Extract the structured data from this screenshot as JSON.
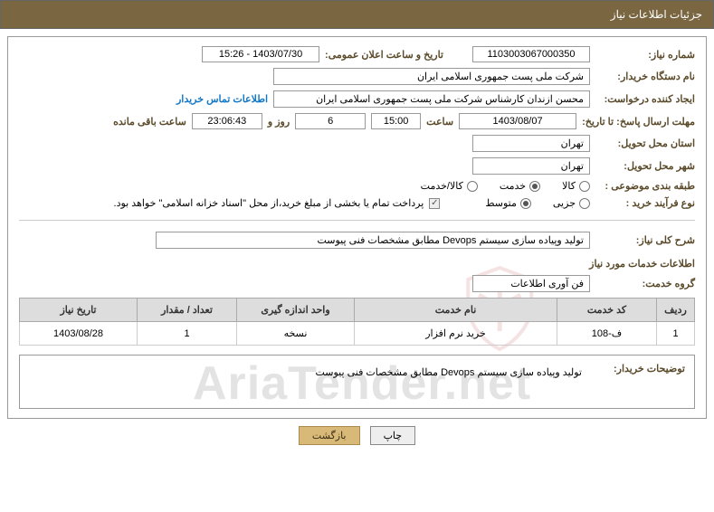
{
  "header": {
    "title": "جزئیات اطلاعات نیاز"
  },
  "fields": {
    "need_number_label": "شماره نیاز:",
    "need_number": "1103003067000350",
    "announce_label": "تاریخ و ساعت اعلان عمومی:",
    "announce_value": "1403/07/30 - 15:26",
    "buyer_org_label": "نام دستگاه خریدار:",
    "buyer_org": "شرکت ملی پست جمهوری اسلامی ایران",
    "requester_label": "ایجاد کننده درخواست:",
    "requester": "محسن ازندان کارشناس شرکت ملی پست جمهوری اسلامی ایران",
    "contact_link": "اطلاعات تماس خریدار",
    "deadline_label": "مهلت ارسال پاسخ: تا تاریخ:",
    "deadline_date": "1403/08/07",
    "time_label": "ساعت",
    "deadline_time": "15:00",
    "days_remaining": "6",
    "days_label": "روز و",
    "countdown": "23:06:43",
    "remaining_label": "ساعت باقی مانده",
    "province_label": "استان محل تحویل:",
    "province": "تهران",
    "city_label": "شهر محل تحویل:",
    "city": "تهران",
    "category_label": "طبقه بندی موضوعی :",
    "cat_goods": "کالا",
    "cat_service": "خدمت",
    "cat_goods_service": "کالا/خدمت",
    "process_label": "نوع فرآیند خرید :",
    "proc_partial": "جزیی",
    "proc_medium": "متوسط",
    "payment_note": "پرداخت تمام یا بخشی از مبلغ خرید،از محل \"اسناد خزانه اسلامی\" خواهد بود.",
    "summary_label": "شرح کلی نیاز:",
    "summary_text": "تولید وپیاده سازی سیستم  Devops مطابق مشخصات فنی پیوست",
    "services_info_label": "اطلاعات خدمات مورد نیاز",
    "service_group_label": "گروه خدمت:",
    "service_group": "فن آوری اطلاعات",
    "buyer_notes_label": "توضیحات خریدار:",
    "buyer_notes": "تولید وپیاده سازی سیستم  Devops مطابق مشخصات فنی پیوست"
  },
  "table": {
    "headers": {
      "row": "ردیف",
      "code": "کد خدمت",
      "name": "نام خدمت",
      "unit": "واحد اندازه گیری",
      "qty": "تعداد / مقدار",
      "date": "تاریخ نیاز"
    },
    "rows": [
      {
        "row": "1",
        "code": "ف-108",
        "name": "خرید نرم افزار",
        "unit": "نسخه",
        "qty": "1",
        "date": "1403/08/28"
      }
    ]
  },
  "buttons": {
    "print": "چاپ",
    "back": "بازگشت"
  },
  "watermark": "AriaTender.net"
}
